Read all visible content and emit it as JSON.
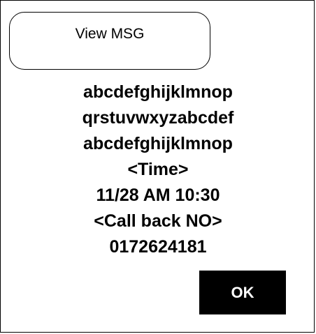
{
  "header": {
    "view_msg_label": "View MSG"
  },
  "message": {
    "lines": [
      "abcdefghijklmnop",
      "qrstuvwxyzabcdef",
      "abcdefghijklmnop"
    ],
    "time_label": "<Time>",
    "time_value": "11/28 AM 10:30",
    "callback_label": "<Call back NO>",
    "callback_value": "0172624181"
  },
  "actions": {
    "ok_label": "OK"
  }
}
